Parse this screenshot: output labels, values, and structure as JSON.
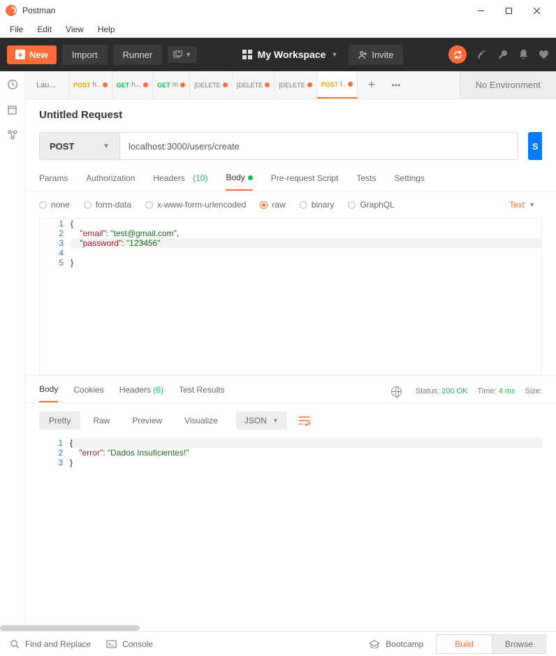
{
  "window": {
    "title": "Postman"
  },
  "menus": {
    "file": "File",
    "edit": "Edit",
    "view": "View",
    "help": "Help"
  },
  "toolbar": {
    "new": "New",
    "import": "Import",
    "runner": "Runner",
    "workspace": "My Workspace",
    "invite": "Invite"
  },
  "tabs": {
    "list": [
      {
        "label": "Lau...",
        "method": "",
        "dot": false
      },
      {
        "label": "h..",
        "method": "POST",
        "dot": true
      },
      {
        "label": "h...",
        "method": "GET",
        "dot": true
      },
      {
        "label": "m",
        "method": "GET",
        "dot": true
      },
      {
        "label": "[DELETE",
        "method": "",
        "dot": true
      },
      {
        "label": "[DELETE",
        "method": "",
        "dot": true
      },
      {
        "label": "[DELETE",
        "method": "",
        "dot": true
      },
      {
        "label": "l..",
        "method": "POST",
        "dot": true,
        "active": true
      }
    ],
    "env": "No Environment"
  },
  "request": {
    "title": "Untitled Request",
    "method": "POST",
    "url": "localhost:3000/users/create",
    "send": "S",
    "tabs": {
      "params": "Params",
      "auth": "Authorization",
      "headers": "Headers",
      "headers_count": "(10)",
      "body": "Body",
      "prereq": "Pre-request Script",
      "tests": "Tests",
      "settings": "Settings"
    },
    "bodytype": {
      "none": "none",
      "formdata": "form-data",
      "urlencoded": "x-www-form-urlencoded",
      "raw": "raw",
      "binary": "binary",
      "graphql": "GraphQL",
      "texttype": "Text"
    },
    "body_lines": {
      "l1": "{",
      "l2_key": "\"email\"",
      "l2_mid": ": ",
      "l2_val": "\"test@gmail.com\"",
      "l2_end": ",",
      "l3_key": "\"password\"",
      "l3_mid": ": ",
      "l3_val": "\"123456\"",
      "l4": "",
      "l5": "}"
    }
  },
  "response": {
    "tabs": {
      "body": "Body",
      "cookies": "Cookies",
      "headers": "Headers",
      "headers_count": "(6)",
      "tests": "Test Results"
    },
    "status_label": "Status:",
    "status_value": "200 OK",
    "time_label": "Time:",
    "time_value": "4 ms",
    "size_label": "Size:",
    "views": {
      "pretty": "Pretty",
      "raw": "Raw",
      "preview": "Preview",
      "visualize": "Visualize",
      "json": "JSON"
    },
    "body_lines": {
      "l1": "{",
      "l2_key": "\"error\"",
      "l2_mid": ": ",
      "l2_val": "\"Dados Insuficientes!\"",
      "l3": "}"
    }
  },
  "footer": {
    "find": "Find and Replace",
    "console": "Console",
    "bootcamp": "Bootcamp",
    "build": "Build",
    "browse": "Browse"
  }
}
